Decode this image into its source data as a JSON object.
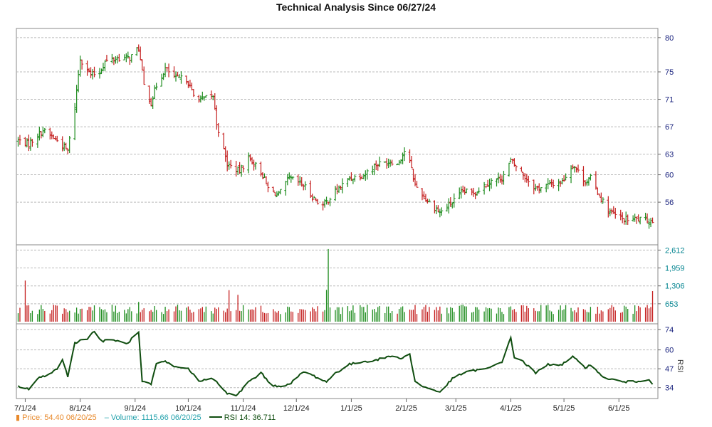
{
  "colors": {
    "up": "#1e8c1e",
    "down": "#c41e1e",
    "rsi": "#0f4d0f",
    "axis_price": "#1a237e",
    "axis_volume": "#00838f",
    "grid": "#bbbbbb",
    "legend_price": "#e8892b",
    "legend_volume": "#26a3ad",
    "legend_rsi": "#0f4d0f"
  },
  "chart_data": [
    {
      "type": "ohlc",
      "title": "Technical Analysis Since 06/27/24",
      "x_tick_labels": [
        "7/1/24",
        "8/1/24",
        "9/1/24",
        "10/1/24",
        "11/1/24",
        "12/1/24",
        "1/1/25",
        "2/1/25",
        "3/1/25",
        "4/1/25",
        "5/1/25",
        "6/1/25"
      ],
      "ylim": [
        50.2,
        80.5
      ],
      "y_ticks": [
        80,
        75,
        71,
        67,
        63,
        60,
        56
      ],
      "grid": true,
      "anchors": [
        [
          "6/27/24",
          65.0
        ],
        [
          "7/3/24",
          64.5
        ],
        [
          "7/11/24",
          66.5
        ],
        [
          "7/19/24",
          65.0
        ],
        [
          "7/25/24",
          63.5
        ],
        [
          "7/29/24",
          70.0
        ],
        [
          "8/1/24",
          77.0
        ],
        [
          "8/7/24",
          74.5
        ],
        [
          "8/12/24",
          75.0
        ],
        [
          "8/15/24",
          76.5
        ],
        [
          "8/22/24",
          77.0
        ],
        [
          "8/29/24",
          77.0
        ],
        [
          "9/3/24",
          78.5
        ],
        [
          "9/6/24",
          73.0
        ],
        [
          "9/10/24",
          70.5
        ],
        [
          "9/13/24",
          73.0
        ],
        [
          "9/18/24",
          75.5
        ],
        [
          "9/24/24",
          74.0
        ],
        [
          "9/30/24",
          74.0
        ],
        [
          "10/4/24",
          71.5
        ],
        [
          "10/9/24",
          71.0
        ],
        [
          "10/15/24",
          71.5
        ],
        [
          "10/17/24",
          67.5
        ],
        [
          "10/23/24",
          61.5
        ],
        [
          "10/30/24",
          60.5
        ],
        [
          "11/4/24",
          62.5
        ],
        [
          "11/11/24",
          60.5
        ],
        [
          "11/15/24",
          58.0
        ],
        [
          "11/21/24",
          57.0
        ],
        [
          "11/27/24",
          59.5
        ],
        [
          "12/5/24",
          58.5
        ],
        [
          "12/11/24",
          56.5
        ],
        [
          "12/16/24",
          55.5
        ],
        [
          "12/23/24",
          57.5
        ],
        [
          "12/31/24",
          59.5
        ],
        [
          "1/8/25",
          60.0
        ],
        [
          "1/15/25",
          61.5
        ],
        [
          "1/24/25",
          62.0
        ],
        [
          "1/27/25",
          61.5
        ],
        [
          "2/1/25",
          64.0
        ],
        [
          "2/6/25",
          58.5
        ],
        [
          "2/12/25",
          56.5
        ],
        [
          "2/20/25",
          54.5
        ],
        [
          "2/27/25",
          56.0
        ],
        [
          "3/5/25",
          57.5
        ],
        [
          "3/12/25",
          57.5
        ],
        [
          "3/20/25",
          59.0
        ],
        [
          "3/27/25",
          59.5
        ],
        [
          "4/1/25",
          62.0
        ],
        [
          "4/3/25",
          61.5
        ],
        [
          "4/8/25",
          60.0
        ],
        [
          "4/15/25",
          58.0
        ],
        [
          "4/22/25",
          58.5
        ],
        [
          "4/30/25",
          59.0
        ],
        [
          "5/6/25",
          61.5
        ],
        [
          "5/13/25",
          59.0
        ],
        [
          "5/16/25",
          59.5
        ],
        [
          "5/22/25",
          56.5
        ],
        [
          "5/27/25",
          54.5
        ],
        [
          "6/3/25",
          53.5
        ],
        [
          "6/10/25",
          53.5
        ],
        [
          "6/20/25",
          53.3
        ]
      ]
    },
    {
      "type": "bar",
      "ylim": [
        0,
        2700
      ],
      "y_ticks": [
        2612,
        1959,
        1306,
        653
      ],
      "y_tick_labels": [
        "2,612",
        "1,959",
        "1,306",
        "653"
      ],
      "grid": true,
      "base_range": [
        280,
        620
      ],
      "spikes": [
        [
          "7/1/24",
          1500
        ],
        [
          "9/3/24",
          720
        ],
        [
          "10/24/24",
          1150
        ],
        [
          "10/29/24",
          980
        ],
        [
          "12/19/24",
          2650
        ],
        [
          "12/18/24",
          1160
        ],
        [
          "6/20/25",
          1115.66
        ]
      ]
    },
    {
      "type": "line",
      "ylabel": "RSI",
      "ylim": [
        27,
        76
      ],
      "y_ticks": [
        74,
        60,
        47,
        34
      ],
      "grid": true,
      "anchors": [
        [
          "6/27/24",
          35
        ],
        [
          "7/3/24",
          33
        ],
        [
          "7/8/24",
          40
        ],
        [
          "7/15/24",
          44
        ],
        [
          "7/19/24",
          47
        ],
        [
          "7/22/24",
          53
        ],
        [
          "7/25/24",
          42
        ],
        [
          "7/29/24",
          65
        ],
        [
          "8/5/24",
          68
        ],
        [
          "8/9/24",
          73
        ],
        [
          "8/13/24",
          66
        ],
        [
          "8/20/24",
          67
        ],
        [
          "8/27/24",
          64
        ],
        [
          "9/3/24",
          72
        ],
        [
          "9/5/24",
          38
        ],
        [
          "9/10/24",
          36
        ],
        [
          "9/13/24",
          50
        ],
        [
          "9/18/24",
          52
        ],
        [
          "9/24/24",
          48
        ],
        [
          "9/30/24",
          48
        ],
        [
          "10/7/24",
          39
        ],
        [
          "10/14/24",
          40
        ],
        [
          "10/17/24",
          38
        ],
        [
          "10/23/24",
          30
        ],
        [
          "10/28/24",
          28
        ],
        [
          "11/4/24",
          38
        ],
        [
          "11/11/24",
          44
        ],
        [
          "11/18/24",
          35
        ],
        [
          "11/27/24",
          36
        ],
        [
          "12/5/24",
          45
        ],
        [
          "12/11/24",
          42
        ],
        [
          "12/18/24",
          38
        ],
        [
          "12/23/24",
          44
        ],
        [
          "12/31/24",
          50
        ],
        [
          "1/8/25",
          52
        ],
        [
          "1/15/25",
          53
        ],
        [
          "1/24/25",
          56
        ],
        [
          "1/28/25",
          54
        ],
        [
          "2/3/25",
          57
        ],
        [
          "2/6/25",
          38
        ],
        [
          "2/12/25",
          34
        ],
        [
          "2/20/25",
          31
        ],
        [
          "2/27/25",
          40
        ],
        [
          "3/5/25",
          44
        ],
        [
          "3/12/25",
          46
        ],
        [
          "3/19/25",
          47
        ],
        [
          "3/27/25",
          52
        ],
        [
          "4/1/25",
          68
        ],
        [
          "4/3/25",
          55
        ],
        [
          "4/8/25",
          52
        ],
        [
          "4/15/25",
          44
        ],
        [
          "4/22/25",
          50
        ],
        [
          "4/30/25",
          50
        ],
        [
          "5/6/25",
          55
        ],
        [
          "5/13/25",
          48
        ],
        [
          "5/16/25",
          50
        ],
        [
          "5/22/25",
          42
        ],
        [
          "5/27/25",
          40
        ],
        [
          "6/3/25",
          38
        ],
        [
          "6/10/25",
          38
        ],
        [
          "6/18/25",
          40
        ],
        [
          "6/20/25",
          36.711
        ]
      ]
    }
  ],
  "legend": {
    "price": "Price: 54.40  06/20/25",
    "volume": "Volume: 1115.66  06/20/25",
    "rsi": "RSI 14: 36.711",
    "price_marker": "▮",
    "volume_marker": "–"
  }
}
